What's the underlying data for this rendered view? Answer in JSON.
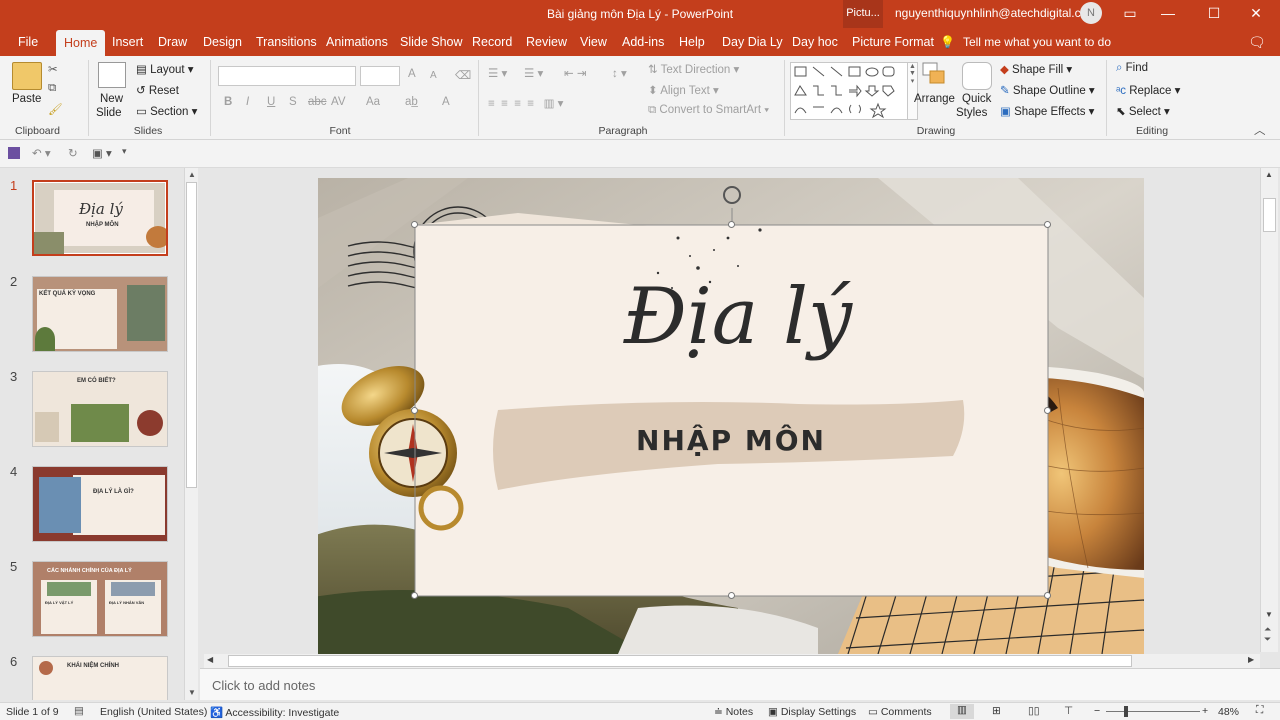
{
  "app": {
    "title": "Bài giảng môn Địa Lý  -  PowerPoint",
    "context_pill": "Pictu...",
    "user_email": "nguyenthiquynhlinh@atechdigital.co",
    "user_initial": "N"
  },
  "tabs": [
    "File",
    "Home",
    "Insert",
    "Draw",
    "Design",
    "Transitions",
    "Animations",
    "Slide Show",
    "Record",
    "Review",
    "View",
    "Add-ins",
    "Help",
    "Day Dia Ly",
    "Day hoc",
    "Picture Format"
  ],
  "tell_me": "Tell me what you want to do",
  "ribbon": {
    "clipboard": {
      "paste": "Paste",
      "label": "Clipboard"
    },
    "slides": {
      "new_slide_1": "New",
      "new_slide_2": "Slide",
      "layout": "Layout",
      "reset": "Reset",
      "section": "Section",
      "label": "Slides"
    },
    "font": {
      "label": "Font",
      "bold": "B",
      "italic": "I",
      "underline": "U",
      "shadow": "S",
      "strike": "abc",
      "spacing": "AV",
      "case": "Aa",
      "grow": "A",
      "shrink": "A"
    },
    "paragraph": {
      "label": "Paragraph",
      "text_direction": "Text Direction",
      "align_text": "Align Text",
      "smartart": "Convert to SmartArt"
    },
    "drawing": {
      "label": "Drawing",
      "arrange": "Arrange",
      "quick_styles_1": "Quick",
      "quick_styles_2": "Styles",
      "shape_fill": "Shape Fill",
      "shape_outline": "Shape Outline",
      "shape_effects": "Shape Effects"
    },
    "editing": {
      "label": "Editing",
      "find": "Find",
      "replace": "Replace",
      "select": "Select"
    }
  },
  "slides": [
    {
      "num": "1",
      "title": "Địa lý",
      "subtitle": "NHẬP MÔN"
    },
    {
      "num": "2",
      "title": "KẾT QUẢ KỲ VỌNG"
    },
    {
      "num": "3",
      "title": "EM CÓ BIẾT?"
    },
    {
      "num": "4",
      "title": "ĐỊA LÝ LÀ GÌ?"
    },
    {
      "num": "5",
      "title": "CÁC NHÁNH CHÍNH CỦA ĐỊA LÝ",
      "left_col": "ĐỊA LÝ VẬT LÝ",
      "right_col": "ĐỊA LÝ NHÂN VĂN"
    },
    {
      "num": "6",
      "title": "KHÁI NIỆM CHÍNH"
    }
  ],
  "current_slide": {
    "title": "Địa lý",
    "subtitle": "NHẬP MÔN"
  },
  "notes_placeholder": "Click to add notes",
  "status": {
    "slide_of": "Slide 1 of 9",
    "language": "English (United States)",
    "accessibility": "Accessibility: Investigate",
    "notes": "Notes",
    "display": "Display Settings",
    "comments": "Comments",
    "zoom": "48%"
  },
  "colors": {
    "accent": "#c43e1c",
    "ribbon": "#f3f3f3",
    "canvas": "#e6e6e6"
  }
}
